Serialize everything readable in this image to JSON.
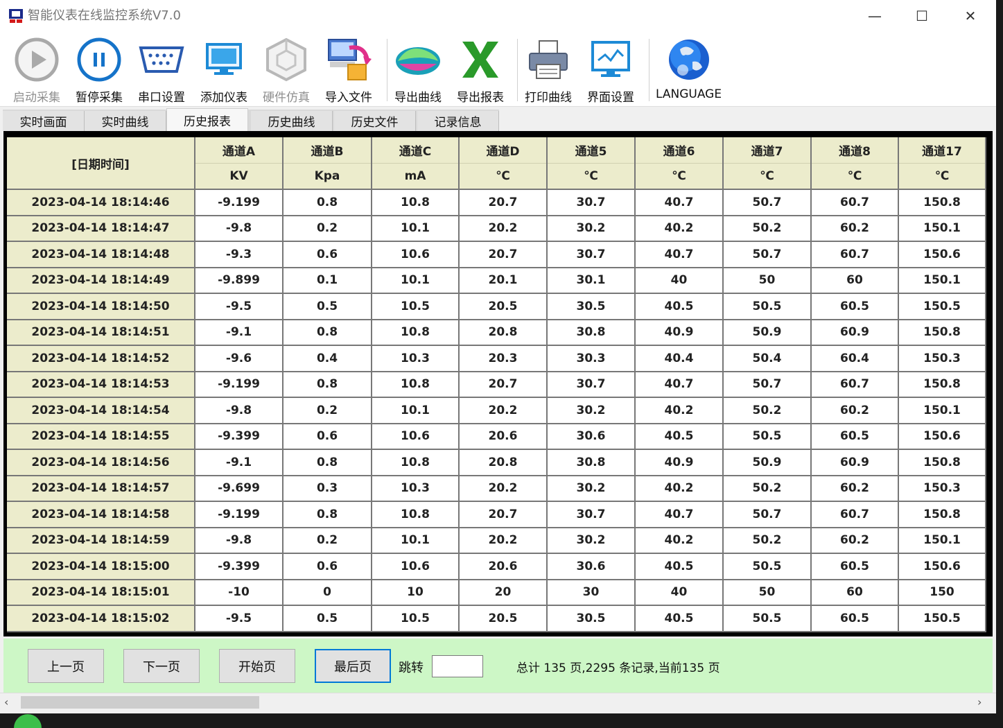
{
  "window": {
    "title": "智能仪表在线监控系统V7.0",
    "minimize_glyph": "—",
    "maximize_glyph": "☐",
    "close_glyph": "✕"
  },
  "toolbar": {
    "items": [
      {
        "label": "启动采集",
        "icon": "play-icon",
        "enabled": false
      },
      {
        "label": "暂停采集",
        "icon": "pause-icon",
        "enabled": true
      },
      {
        "label": "串口设置",
        "icon": "serial-port-icon",
        "enabled": true
      },
      {
        "label": "添加仪表",
        "icon": "monitor-icon",
        "enabled": true
      },
      {
        "label": "硬件仿真",
        "icon": "cube-icon",
        "enabled": false
      },
      {
        "label": "导入文件",
        "icon": "import-file-icon",
        "enabled": true
      },
      {
        "label": "导出曲线",
        "icon": "export-curve-icon",
        "enabled": true
      },
      {
        "label": "导出报表",
        "icon": "excel-icon",
        "enabled": true
      },
      {
        "label": "打印曲线",
        "icon": "printer-icon",
        "enabled": true
      },
      {
        "label": "界面设置",
        "icon": "screen-settings-icon",
        "enabled": true
      },
      {
        "label": "LANGUAGE",
        "icon": "globe-icon",
        "enabled": true
      }
    ]
  },
  "tabs": [
    {
      "label": "实时画面",
      "active": false
    },
    {
      "label": "实时曲线",
      "active": false
    },
    {
      "label": "历史报表",
      "active": true
    },
    {
      "label": "历史曲线",
      "active": false
    },
    {
      "label": "历史文件",
      "active": false
    },
    {
      "label": "记录信息",
      "active": false
    }
  ],
  "table": {
    "date_header": "[日期时间]",
    "columns": [
      {
        "name": "通道A",
        "unit": "KV"
      },
      {
        "name": "通道B",
        "unit": "Kpa"
      },
      {
        "name": "通道C",
        "unit": "mA"
      },
      {
        "name": "通道D",
        "unit": "℃"
      },
      {
        "name": "通道5",
        "unit": "℃"
      },
      {
        "name": "通道6",
        "unit": "℃"
      },
      {
        "name": "通道7",
        "unit": "℃"
      },
      {
        "name": "通道8",
        "unit": "℃"
      },
      {
        "name": "通道17",
        "unit": "℃"
      }
    ],
    "rows": [
      {
        "time": "2023-04-14 18:14:46",
        "values": [
          "-9.199",
          "0.8",
          "10.8",
          "20.7",
          "30.7",
          "40.7",
          "50.7",
          "60.7",
          "150.8"
        ]
      },
      {
        "time": "2023-04-14 18:14:47",
        "values": [
          "-9.8",
          "0.2",
          "10.1",
          "20.2",
          "30.2",
          "40.2",
          "50.2",
          "60.2",
          "150.1"
        ]
      },
      {
        "time": "2023-04-14 18:14:48",
        "values": [
          "-9.3",
          "0.6",
          "10.6",
          "20.7",
          "30.7",
          "40.7",
          "50.7",
          "60.7",
          "150.6"
        ]
      },
      {
        "time": "2023-04-14 18:14:49",
        "values": [
          "-9.899",
          "0.1",
          "10.1",
          "20.1",
          "30.1",
          "40",
          "50",
          "60",
          "150.1"
        ]
      },
      {
        "time": "2023-04-14 18:14:50",
        "values": [
          "-9.5",
          "0.5",
          "10.5",
          "20.5",
          "30.5",
          "40.5",
          "50.5",
          "60.5",
          "150.5"
        ]
      },
      {
        "time": "2023-04-14 18:14:51",
        "values": [
          "-9.1",
          "0.8",
          "10.8",
          "20.8",
          "30.8",
          "40.9",
          "50.9",
          "60.9",
          "150.8"
        ]
      },
      {
        "time": "2023-04-14 18:14:52",
        "values": [
          "-9.6",
          "0.4",
          "10.3",
          "20.3",
          "30.3",
          "40.4",
          "50.4",
          "60.4",
          "150.3"
        ]
      },
      {
        "time": "2023-04-14 18:14:53",
        "values": [
          "-9.199",
          "0.8",
          "10.8",
          "20.7",
          "30.7",
          "40.7",
          "50.7",
          "60.7",
          "150.8"
        ]
      },
      {
        "time": "2023-04-14 18:14:54",
        "values": [
          "-9.8",
          "0.2",
          "10.1",
          "20.2",
          "30.2",
          "40.2",
          "50.2",
          "60.2",
          "150.1"
        ]
      },
      {
        "time": "2023-04-14 18:14:55",
        "values": [
          "-9.399",
          "0.6",
          "10.6",
          "20.6",
          "30.6",
          "40.5",
          "50.5",
          "60.5",
          "150.6"
        ]
      },
      {
        "time": "2023-04-14 18:14:56",
        "values": [
          "-9.1",
          "0.8",
          "10.8",
          "20.8",
          "30.8",
          "40.9",
          "50.9",
          "60.9",
          "150.8"
        ]
      },
      {
        "time": "2023-04-14 18:14:57",
        "values": [
          "-9.699",
          "0.3",
          "10.3",
          "20.2",
          "30.2",
          "40.2",
          "50.2",
          "60.2",
          "150.3"
        ]
      },
      {
        "time": "2023-04-14 18:14:58",
        "values": [
          "-9.199",
          "0.8",
          "10.8",
          "20.7",
          "30.7",
          "40.7",
          "50.7",
          "60.7",
          "150.8"
        ]
      },
      {
        "time": "2023-04-14 18:14:59",
        "values": [
          "-9.8",
          "0.2",
          "10.1",
          "20.2",
          "30.2",
          "40.2",
          "50.2",
          "60.2",
          "150.1"
        ]
      },
      {
        "time": "2023-04-14 18:15:00",
        "values": [
          "-9.399",
          "0.6",
          "10.6",
          "20.6",
          "30.6",
          "40.5",
          "50.5",
          "60.5",
          "150.6"
        ]
      },
      {
        "time": "2023-04-14 18:15:01",
        "values": [
          "-10",
          "0",
          "10",
          "20",
          "30",
          "40",
          "50",
          "60",
          "150"
        ]
      },
      {
        "time": "2023-04-14 18:15:02",
        "values": [
          "-9.5",
          "0.5",
          "10.5",
          "20.5",
          "30.5",
          "40.5",
          "50.5",
          "60.5",
          "150.5"
        ]
      }
    ]
  },
  "pager": {
    "prev_label": "上一页",
    "next_label": "下一页",
    "first_label": "开始页",
    "last_label": "最后页",
    "jump_label": "跳转",
    "jump_value": "",
    "status": "总计 135 页,2295 条记录,当前135 页"
  },
  "scrollbar": {
    "left_glyph": "‹",
    "right_glyph": "›"
  }
}
